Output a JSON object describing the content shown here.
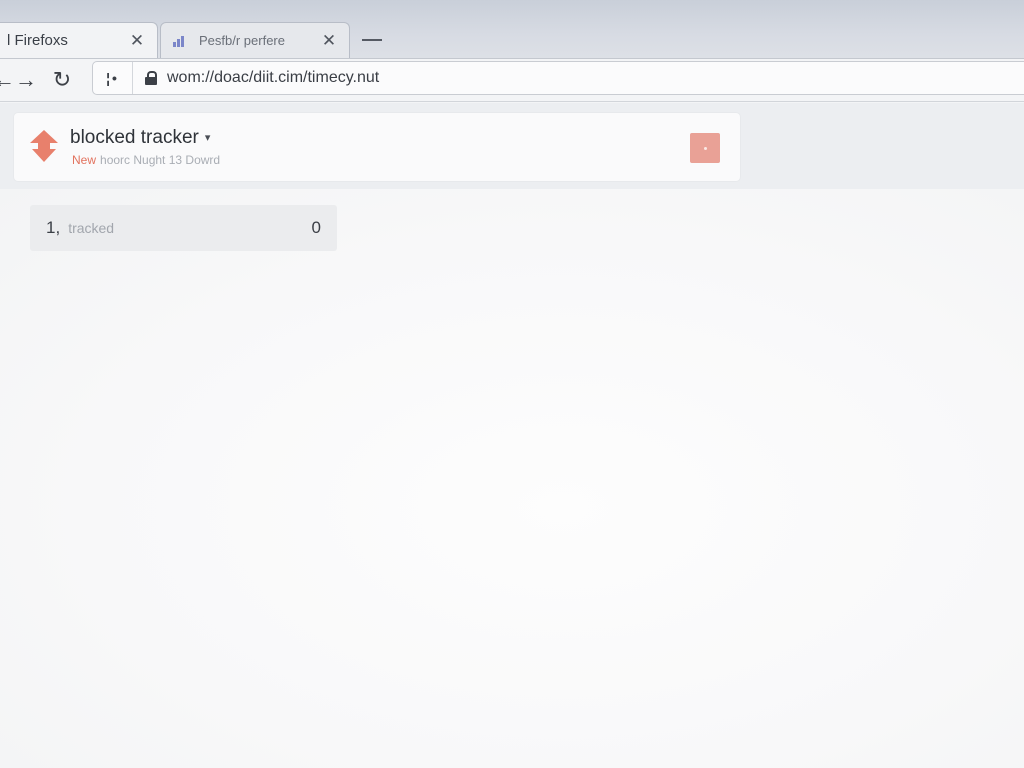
{
  "browser": {
    "tabs": [
      {
        "title": "l Firefoxs",
        "close_glyph": "✕",
        "active": true
      },
      {
        "title": "Pesfb/r perfere",
        "close_glyph": "✕",
        "active": false
      }
    ],
    "nav": {
      "back_glyph": "←",
      "forward_glyph": "→",
      "reload_glyph": "↻"
    },
    "url": {
      "permissions_glyph": "¦•",
      "text": "wom://doac/diit.cim/timecy.nut"
    }
  },
  "panel": {
    "title": "blocked tracker",
    "caret_glyph": "▾",
    "subtitle_badge": "New",
    "subtitle_text": "hoorc Nught 13 Dowrd",
    "icon": "shield-icon",
    "action_icon": "block-icon",
    "accent_color": "#e2725e"
  },
  "tracker_list": [
    {
      "index": "1,",
      "label": "tracked",
      "count": "0"
    }
  ]
}
